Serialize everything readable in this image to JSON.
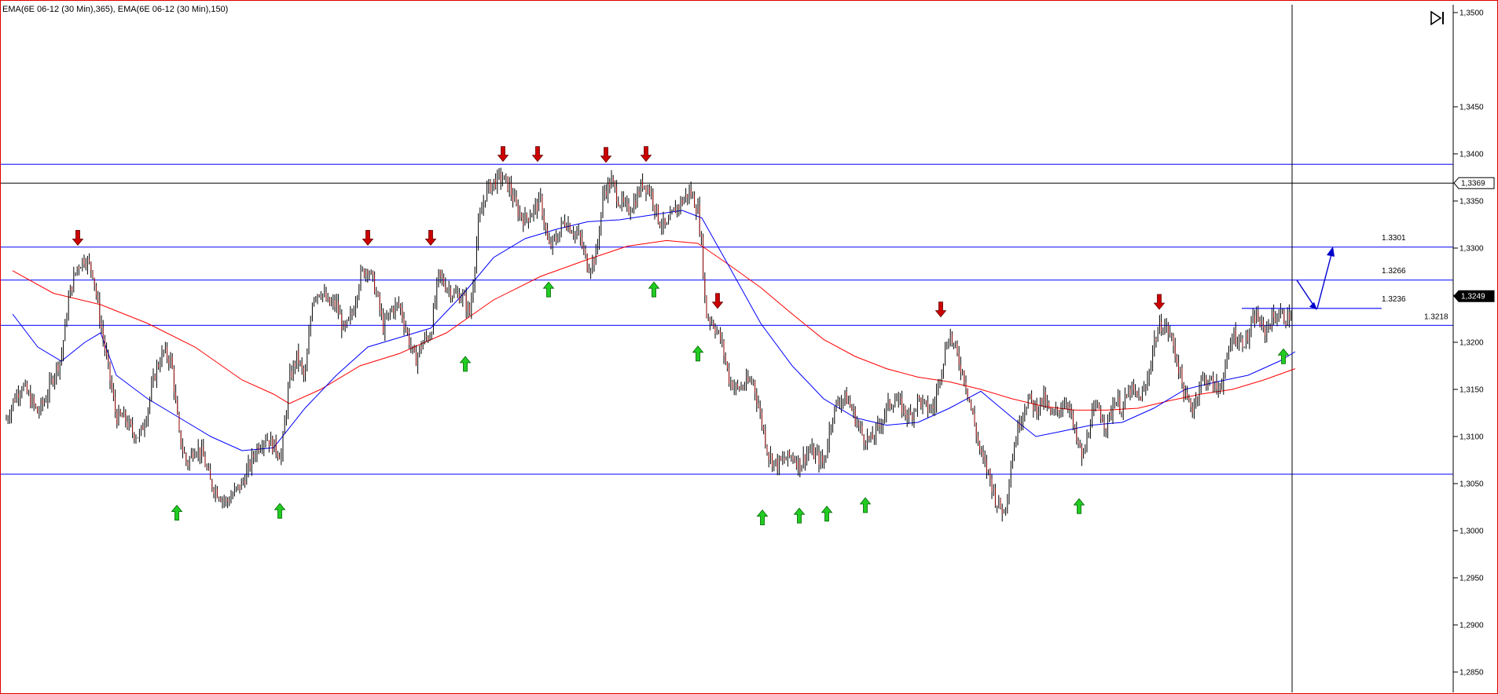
{
  "chart_data": {
    "type": "candlestick",
    "title": "",
    "legend": "EMA(6E 06-12 (30 Min),365), EMA(6E 06-12 (30 Min),150)",
    "series": [
      {
        "name": "EMA(6E 06-12 (30 Min),365)",
        "color": "#ff0000"
      },
      {
        "name": "EMA(6E 06-12 (30 Min),150)",
        "color": "#0000ff"
      }
    ],
    "ylim": [
      1.2835,
      1.3555
    ],
    "y_ticks": [
      1.355,
      1.345,
      1.34,
      1.335,
      1.33,
      1.325,
      1.32,
      1.315,
      1.31,
      1.305,
      1.3,
      1.295,
      1.29,
      1.285
    ],
    "y_tick_labels": [
      "1,3500",
      "1,3450",
      "1,3400",
      "1,3350",
      "1,3300",
      "1,3250",
      "1,3200",
      "1,3150",
      "1,3100",
      "1,3050",
      "1,3000",
      "1,2950",
      "1,2900",
      "1,2850"
    ],
    "price_tags": [
      {
        "label": "1,3369",
        "value": 1.3369,
        "style": "light"
      },
      {
        "label": "1,3249",
        "value": 1.3249,
        "style": "dark"
      }
    ],
    "horizontal_levels": [
      {
        "value": 1.3389,
        "color": "#0000ff"
      },
      {
        "value": 1.3369,
        "color": "#000000"
      },
      {
        "value": 1.3301,
        "color": "#0000ff"
      },
      {
        "value": 1.3266,
        "color": "#0000ff"
      },
      {
        "value": 1.3218,
        "color": "#0000ff"
      },
      {
        "value": 1.306,
        "color": "#0000ff"
      }
    ],
    "level_labels": [
      {
        "label": "1.3301",
        "value": 1.3301
      },
      {
        "label": "1.3266",
        "value": 1.3266
      },
      {
        "label": "1.3236",
        "value": 1.3236
      },
      {
        "label": "1.3218",
        "value": 1.3218
      }
    ],
    "price_path": [
      [
        0,
        1.3118
      ],
      [
        10,
        1.314
      ],
      [
        20,
        1.3155
      ],
      [
        30,
        1.314
      ],
      [
        40,
        1.3125
      ],
      [
        50,
        1.314
      ],
      [
        60,
        1.3165
      ],
      [
        70,
        1.3185
      ],
      [
        80,
        1.325
      ],
      [
        90,
        1.328
      ],
      [
        100,
        1.329
      ],
      [
        110,
        1.3275
      ],
      [
        120,
        1.322
      ],
      [
        130,
        1.317
      ],
      [
        140,
        1.312
      ],
      [
        150,
        1.312
      ],
      [
        160,
        1.3105
      ],
      [
        170,
        1.31
      ],
      [
        180,
        1.313
      ],
      [
        190,
        1.317
      ],
      [
        200,
        1.319
      ],
      [
        210,
        1.318
      ],
      [
        220,
        1.31
      ],
      [
        230,
        1.307
      ],
      [
        240,
        1.309
      ],
      [
        250,
        1.308
      ],
      [
        260,
        1.305
      ],
      [
        270,
        1.304
      ],
      [
        280,
        1.303
      ],
      [
        290,
        1.304
      ],
      [
        300,
        1.305
      ],
      [
        310,
        1.307
      ],
      [
        320,
        1.309
      ],
      [
        330,
        1.31
      ],
      [
        340,
        1.309
      ],
      [
        350,
        1.308
      ],
      [
        360,
        1.316
      ],
      [
        370,
        1.3185
      ],
      [
        380,
        1.316
      ],
      [
        390,
        1.325
      ],
      [
        400,
        1.3255
      ],
      [
        410,
        1.324
      ],
      [
        420,
        1.324
      ],
      [
        430,
        1.321
      ],
      [
        440,
        1.323
      ],
      [
        450,
        1.327
      ],
      [
        460,
        1.328
      ],
      [
        470,
        1.3255
      ],
      [
        480,
        1.3215
      ],
      [
        490,
        1.3235
      ],
      [
        500,
        1.324
      ],
      [
        510,
        1.321
      ],
      [
        520,
        1.318
      ],
      [
        530,
        1.32
      ],
      [
        540,
        1.321
      ],
      [
        550,
        1.327
      ],
      [
        560,
        1.326
      ],
      [
        570,
        1.325
      ],
      [
        580,
        1.325
      ],
      [
        590,
        1.323
      ],
      [
        600,
        1.332
      ],
      [
        610,
        1.336
      ],
      [
        620,
        1.337
      ],
      [
        630,
        1.3375
      ],
      [
        640,
        1.3365
      ],
      [
        650,
        1.334
      ],
      [
        660,
        1.333
      ],
      [
        670,
        1.334
      ],
      [
        680,
        1.335
      ],
      [
        690,
        1.33
      ],
      [
        700,
        1.331
      ],
      [
        710,
        1.333
      ],
      [
        720,
        1.332
      ],
      [
        730,
        1.331
      ],
      [
        740,
        1.328
      ],
      [
        750,
        1.329
      ],
      [
        760,
        1.336
      ],
      [
        770,
        1.337
      ],
      [
        780,
        1.335
      ],
      [
        790,
        1.334
      ],
      [
        800,
        1.335
      ],
      [
        810,
        1.337
      ],
      [
        820,
        1.336
      ],
      [
        830,
        1.333
      ],
      [
        840,
        1.332
      ],
      [
        850,
        1.334
      ],
      [
        860,
        1.335
      ],
      [
        870,
        1.336
      ],
      [
        880,
        1.334
      ],
      [
        885,
        1.33
      ],
      [
        890,
        1.323
      ],
      [
        900,
        1.322
      ],
      [
        910,
        1.32
      ],
      [
        920,
        1.316
      ],
      [
        930,
        1.315
      ],
      [
        940,
        1.3155
      ],
      [
        950,
        1.316
      ],
      [
        960,
        1.312
      ],
      [
        970,
        1.308
      ],
      [
        980,
        1.307
      ],
      [
        990,
        1.3075
      ],
      [
        1000,
        1.308
      ],
      [
        1010,
        1.307
      ],
      [
        1020,
        1.3085
      ],
      [
        1030,
        1.308
      ],
      [
        1040,
        1.307
      ],
      [
        1050,
        1.312
      ],
      [
        1060,
        1.314
      ],
      [
        1070,
        1.314
      ],
      [
        1080,
        1.312
      ],
      [
        1090,
        1.31
      ],
      [
        1100,
        1.3095
      ],
      [
        1110,
        1.311
      ],
      [
        1120,
        1.313
      ],
      [
        1130,
        1.314
      ],
      [
        1140,
        1.313
      ],
      [
        1150,
        1.312
      ],
      [
        1160,
        1.314
      ],
      [
        1170,
        1.313
      ],
      [
        1180,
        1.313
      ],
      [
        1190,
        1.3175
      ],
      [
        1200,
        1.321
      ],
      [
        1210,
        1.3185
      ],
      [
        1220,
        1.316
      ],
      [
        1230,
        1.312
      ],
      [
        1240,
        1.308
      ],
      [
        1250,
        1.306
      ],
      [
        1260,
        1.303
      ],
      [
        1270,
        1.302
      ],
      [
        1280,
        1.308
      ],
      [
        1290,
        1.312
      ],
      [
        1300,
        1.314
      ],
      [
        1310,
        1.313
      ],
      [
        1320,
        1.314
      ],
      [
        1330,
        1.312
      ],
      [
        1340,
        1.313
      ],
      [
        1350,
        1.314
      ],
      [
        1360,
        1.31
      ],
      [
        1370,
        1.3075
      ],
      [
        1380,
        1.312
      ],
      [
        1390,
        1.313
      ],
      [
        1400,
        1.311
      ],
      [
        1410,
        1.314
      ],
      [
        1420,
        1.313
      ],
      [
        1430,
        1.315
      ],
      [
        1440,
        1.314
      ],
      [
        1450,
        1.315
      ],
      [
        1460,
        1.32
      ],
      [
        1470,
        1.322
      ],
      [
        1480,
        1.321
      ],
      [
        1490,
        1.318
      ],
      [
        1500,
        1.314
      ],
      [
        1510,
        1.313
      ],
      [
        1520,
        1.316
      ],
      [
        1530,
        1.316
      ],
      [
        1540,
        1.315
      ],
      [
        1550,
        1.3165
      ],
      [
        1560,
        1.321
      ],
      [
        1570,
        1.32
      ],
      [
        1580,
        1.3205
      ],
      [
        1590,
        1.323
      ],
      [
        1600,
        1.321
      ],
      [
        1610,
        1.3225
      ],
      [
        1620,
        1.323
      ],
      [
        1630,
        1.3225
      ],
      [
        1640,
        1.324
      ],
      [
        1645,
        1.326
      ],
      [
        1648,
        1.3249
      ]
    ],
    "ema_365": [
      [
        8,
        1.3276
      ],
      [
        60,
        1.3252
      ],
      [
        120,
        1.324
      ],
      [
        180,
        1.322
      ],
      [
        240,
        1.3195
      ],
      [
        300,
        1.316
      ],
      [
        340,
        1.3145
      ],
      [
        360,
        1.3135
      ],
      [
        400,
        1.315
      ],
      [
        450,
        1.3175
      ],
      [
        500,
        1.3188
      ],
      [
        560,
        1.321
      ],
      [
        620,
        1.3245
      ],
      [
        680,
        1.327
      ],
      [
        740,
        1.3288
      ],
      [
        790,
        1.3302
      ],
      [
        840,
        1.3308
      ],
      [
        880,
        1.3305
      ],
      [
        920,
        1.3282
      ],
      [
        960,
        1.3258
      ],
      [
        1000,
        1.323
      ],
      [
        1040,
        1.3203
      ],
      [
        1080,
        1.3185
      ],
      [
        1120,
        1.3172
      ],
      [
        1160,
        1.3163
      ],
      [
        1200,
        1.3158
      ],
      [
        1240,
        1.315
      ],
      [
        1280,
        1.314
      ],
      [
        1320,
        1.3132
      ],
      [
        1360,
        1.3128
      ],
      [
        1400,
        1.3128
      ],
      [
        1440,
        1.313
      ],
      [
        1480,
        1.3138
      ],
      [
        1520,
        1.3145
      ],
      [
        1560,
        1.315
      ],
      [
        1600,
        1.316
      ],
      [
        1640,
        1.3172
      ]
    ],
    "ema_150": [
      [
        8,
        1.323
      ],
      [
        40,
        1.3195
      ],
      [
        70,
        1.318
      ],
      [
        100,
        1.32
      ],
      [
        120,
        1.321
      ],
      [
        140,
        1.3165
      ],
      [
        180,
        1.314
      ],
      [
        220,
        1.312
      ],
      [
        260,
        1.31
      ],
      [
        300,
        1.3085
      ],
      [
        340,
        1.3088
      ],
      [
        380,
        1.313
      ],
      [
        420,
        1.3165
      ],
      [
        460,
        1.3195
      ],
      [
        500,
        1.3205
      ],
      [
        540,
        1.3215
      ],
      [
        580,
        1.325
      ],
      [
        620,
        1.329
      ],
      [
        660,
        1.331
      ],
      [
        700,
        1.332
      ],
      [
        740,
        1.3328
      ],
      [
        780,
        1.333
      ],
      [
        820,
        1.3335
      ],
      [
        860,
        1.334
      ],
      [
        885,
        1.3332
      ],
      [
        920,
        1.328
      ],
      [
        960,
        1.322
      ],
      [
        1000,
        1.3175
      ],
      [
        1040,
        1.314
      ],
      [
        1080,
        1.312
      ],
      [
        1120,
        1.3112
      ],
      [
        1160,
        1.3115
      ],
      [
        1200,
        1.313
      ],
      [
        1240,
        1.3148
      ],
      [
        1280,
        1.312
      ],
      [
        1310,
        1.31
      ],
      [
        1340,
        1.3105
      ],
      [
        1380,
        1.3112
      ],
      [
        1420,
        1.3115
      ],
      [
        1460,
        1.313
      ],
      [
        1500,
        1.315
      ],
      [
        1540,
        1.3158
      ],
      [
        1580,
        1.3165
      ],
      [
        1620,
        1.318
      ],
      [
        1640,
        1.319
      ]
    ],
    "down_arrows": [
      [
        99,
        1.3303
      ],
      [
        468,
        1.3303
      ],
      [
        548,
        1.3303
      ],
      [
        640,
        1.3392
      ],
      [
        684,
        1.3392
      ],
      [
        771,
        1.3391
      ],
      [
        822,
        1.3392
      ],
      [
        913,
        1.3236
      ],
      [
        1197,
        1.3227
      ],
      [
        1475,
        1.3235
      ]
    ],
    "up_arrows": [
      [
        225,
        1.3027
      ],
      [
        356,
        1.3029
      ],
      [
        592,
        1.3185
      ],
      [
        698,
        1.3264
      ],
      [
        832,
        1.3264
      ],
      [
        888,
        1.3196
      ],
      [
        970,
        1.3022
      ],
      [
        1017,
        1.3024
      ],
      [
        1052,
        1.3026
      ],
      [
        1101,
        1.3035
      ],
      [
        1373,
        1.3034
      ],
      [
        1633,
        1.3193
      ]
    ],
    "annotation": {
      "segment": {
        "x1": 1580,
        "x2": 1758,
        "value": 1.3236
      },
      "arrow_down": {
        "x1": 1650,
        "x2": 1676,
        "v1": 1.3266,
        "v2": 1.3236
      },
      "arrow_up": {
        "x1": 1676,
        "x2": 1696,
        "v1": 1.3236,
        "v2": 1.33
      }
    }
  }
}
